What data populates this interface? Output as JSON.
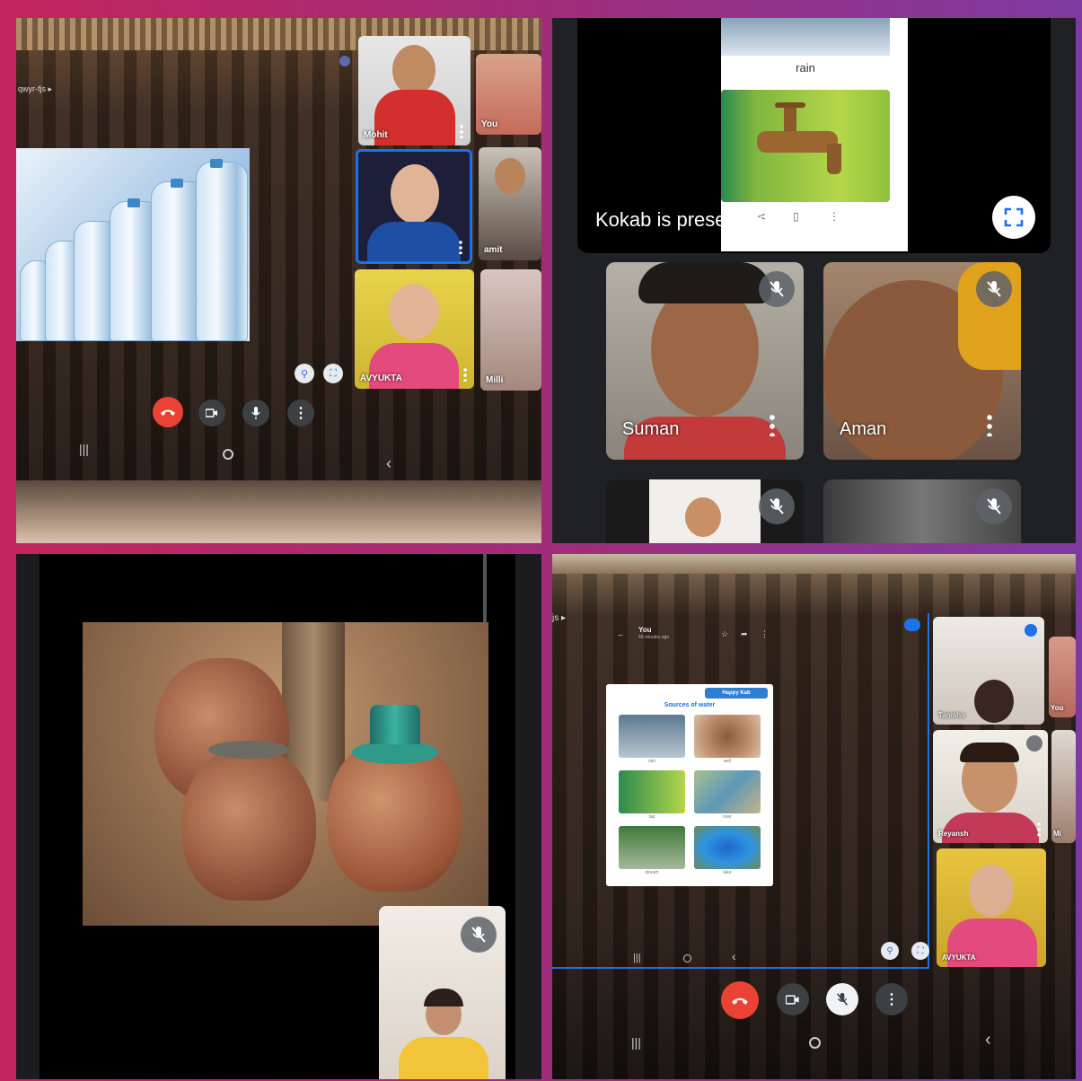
{
  "panels": {
    "p1": {
      "top_label": "qwyr-fjs ▸",
      "participants": [
        "Mohit",
        "You",
        "",
        "amit",
        "AVYUKTA",
        "Milli"
      ]
    },
    "p2": {
      "slide_caption": "rain",
      "presenter_banner": "Kokab is presenting",
      "participants": [
        "Suman",
        "Aman"
      ]
    },
    "p3": {},
    "p4": {
      "header_title": "You",
      "header_subtitle": "49 minutes ago",
      "top_label": "js ▸",
      "worksheet_title": "Sources of water",
      "worksheet_logo": "Happy Kab",
      "worksheet_items": [
        "rain",
        "well",
        "tap",
        "river",
        "stream",
        "lake"
      ],
      "participants": [
        "Tanisha",
        "You",
        "Reyansh",
        "Mi",
        "AVYUKTA"
      ]
    }
  },
  "colors": {
    "frame_left": "#c2255c",
    "frame_right": "#7e3aa0",
    "end_call": "#ea4335",
    "control_gray": "#3c4043"
  },
  "icons": [
    "end-call-icon",
    "camera-icon",
    "mic-icon",
    "more-vert-icon",
    "mic-off-icon",
    "fullscreen-icon",
    "pin-icon",
    "recents-icon",
    "home-icon",
    "back-icon"
  ]
}
